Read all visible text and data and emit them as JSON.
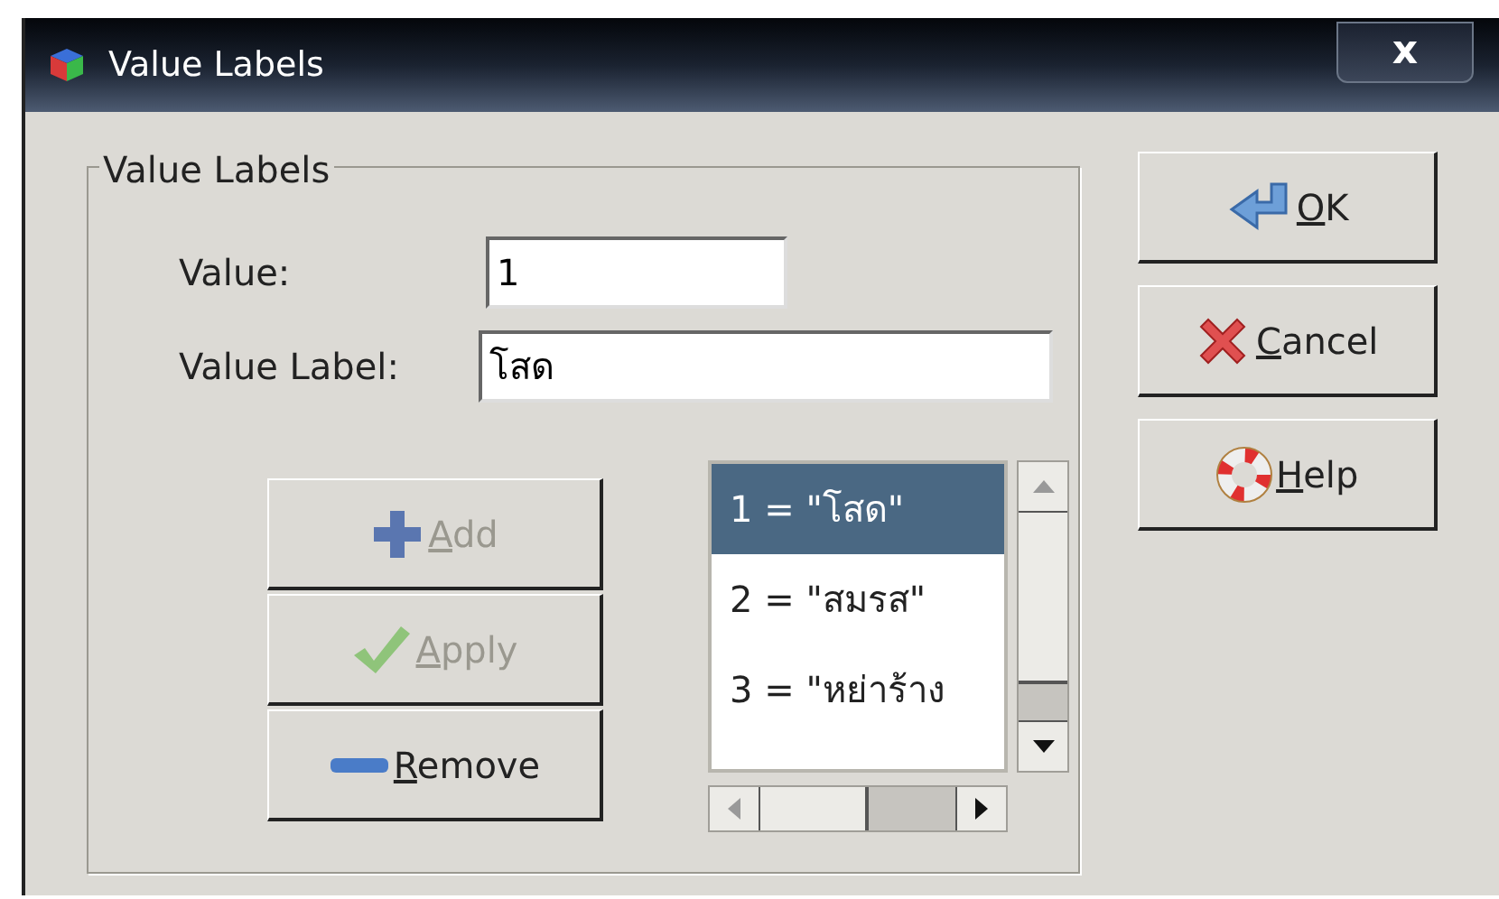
{
  "window": {
    "title": "Value Labels",
    "close": "x"
  },
  "group": {
    "title": "Value Labels"
  },
  "fields": [
    {
      "label": "Value:",
      "value": "1"
    },
    {
      "label": "Value Label:",
      "value": "โสด"
    }
  ],
  "edit_buttons": [
    {
      "underlined": "A",
      "after": "dd",
      "disabled": true,
      "kind": "plus"
    },
    {
      "underlined": "A",
      "after": "pply",
      "disabled": true,
      "kind": "check"
    },
    {
      "underlined": "R",
      "after": "emove",
      "disabled": false,
      "kind": "minus"
    }
  ],
  "labels_list": [
    {
      "text": "1 = \"โสด\"",
      "selected": true
    },
    {
      "text": "2 = \"สมรส\"",
      "selected": false
    },
    {
      "text": "3 = \"หย่าร้าง",
      "selected": false
    }
  ],
  "dialog_buttons": [
    {
      "underlined": "O",
      "after": "K",
      "kind": "ok"
    },
    {
      "underlined": "C",
      "after": "ancel",
      "kind": "cancel"
    },
    {
      "underlined": "H",
      "after": "elp",
      "kind": "help"
    }
  ]
}
